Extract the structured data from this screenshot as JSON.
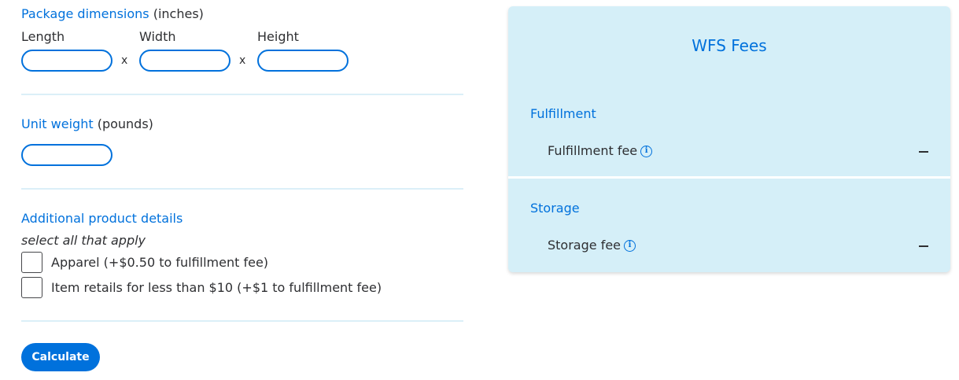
{
  "dimensions": {
    "title": "Package dimensions",
    "unit": "(inches)",
    "length_label": "Length",
    "width_label": "Width",
    "height_label": "Height",
    "times_symbol": "x",
    "length_value": "",
    "width_value": "",
    "height_value": ""
  },
  "weight": {
    "title": "Unit weight",
    "unit": "(pounds)",
    "value": ""
  },
  "details": {
    "title": "Additional product details",
    "hint": "select all that apply",
    "options": [
      {
        "label": "Apparel (+$0.50 to fulfillment fee)",
        "checked": false
      },
      {
        "label": "Item retails for less than $10 (+$1 to fulfillment fee)",
        "checked": false
      }
    ]
  },
  "actions": {
    "calculate_label": "Calculate"
  },
  "fees_panel": {
    "title": "WFS Fees",
    "fulfillment_section": "Fulfillment",
    "fulfillment_fee_label": "Fulfillment fee",
    "fulfillment_fee_value": "—",
    "storage_section": "Storage",
    "storage_fee_label": "Storage fee",
    "storage_fee_value": "—",
    "info_glyph": "i"
  },
  "colors": {
    "accent": "#0071dc",
    "panel_bg": "#d5eff8",
    "divider": "#dbeff8",
    "text": "#2e2f32"
  }
}
